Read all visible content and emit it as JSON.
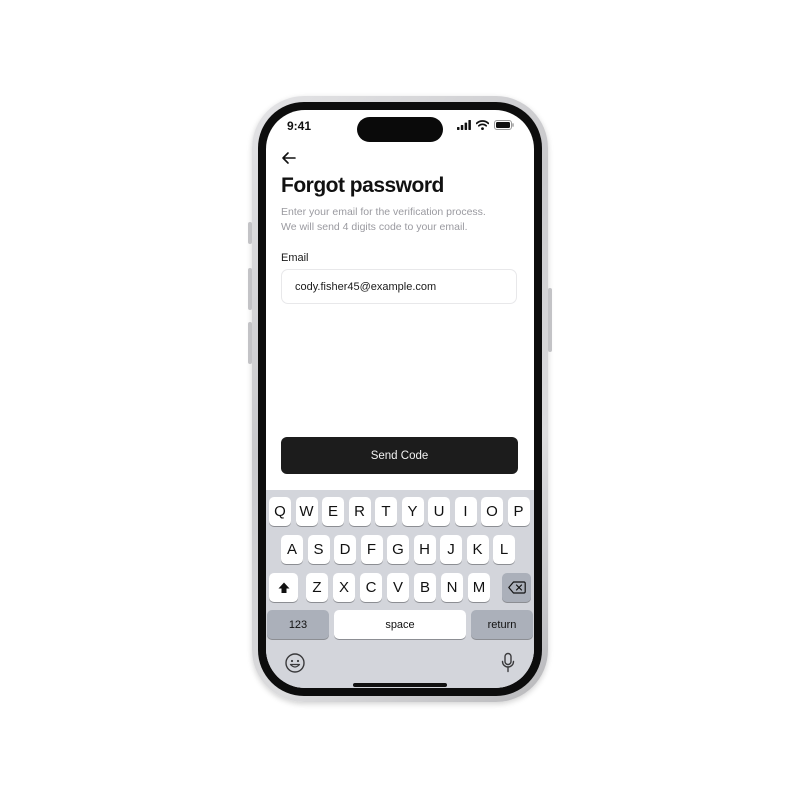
{
  "status_bar": {
    "time": "9:41"
  },
  "screen": {
    "title": "Forgot password",
    "subtitle_lines": [
      "Enter your email for the verification process.",
      "We will send 4 digits code to your email."
    ],
    "email_label": "Email",
    "email_value": "cody.fisher45@example.com",
    "send_button_label": "Send Code"
  },
  "keyboard": {
    "row1": [
      "Q",
      "W",
      "E",
      "R",
      "T",
      "Y",
      "U",
      "I",
      "O",
      "P"
    ],
    "row2": [
      "A",
      "S",
      "D",
      "F",
      "G",
      "H",
      "J",
      "K",
      "L"
    ],
    "row3": [
      "Z",
      "X",
      "C",
      "V",
      "B",
      "N",
      "M"
    ],
    "numbers_key": "123",
    "space_key": "space",
    "return_key": "return"
  },
  "icons": {
    "back": "arrow-left-icon",
    "signal": "cellular-signal-icon",
    "wifi": "wifi-icon",
    "battery": "battery-icon",
    "shift": "shift-icon",
    "delete": "backspace-icon",
    "emoji": "emoji-icon",
    "mic": "microphone-icon"
  },
  "colors": {
    "primary_button": "#1c1c1c",
    "keyboard_bg": "#d3d5db",
    "subtitle_text": "#9a9aa0"
  }
}
